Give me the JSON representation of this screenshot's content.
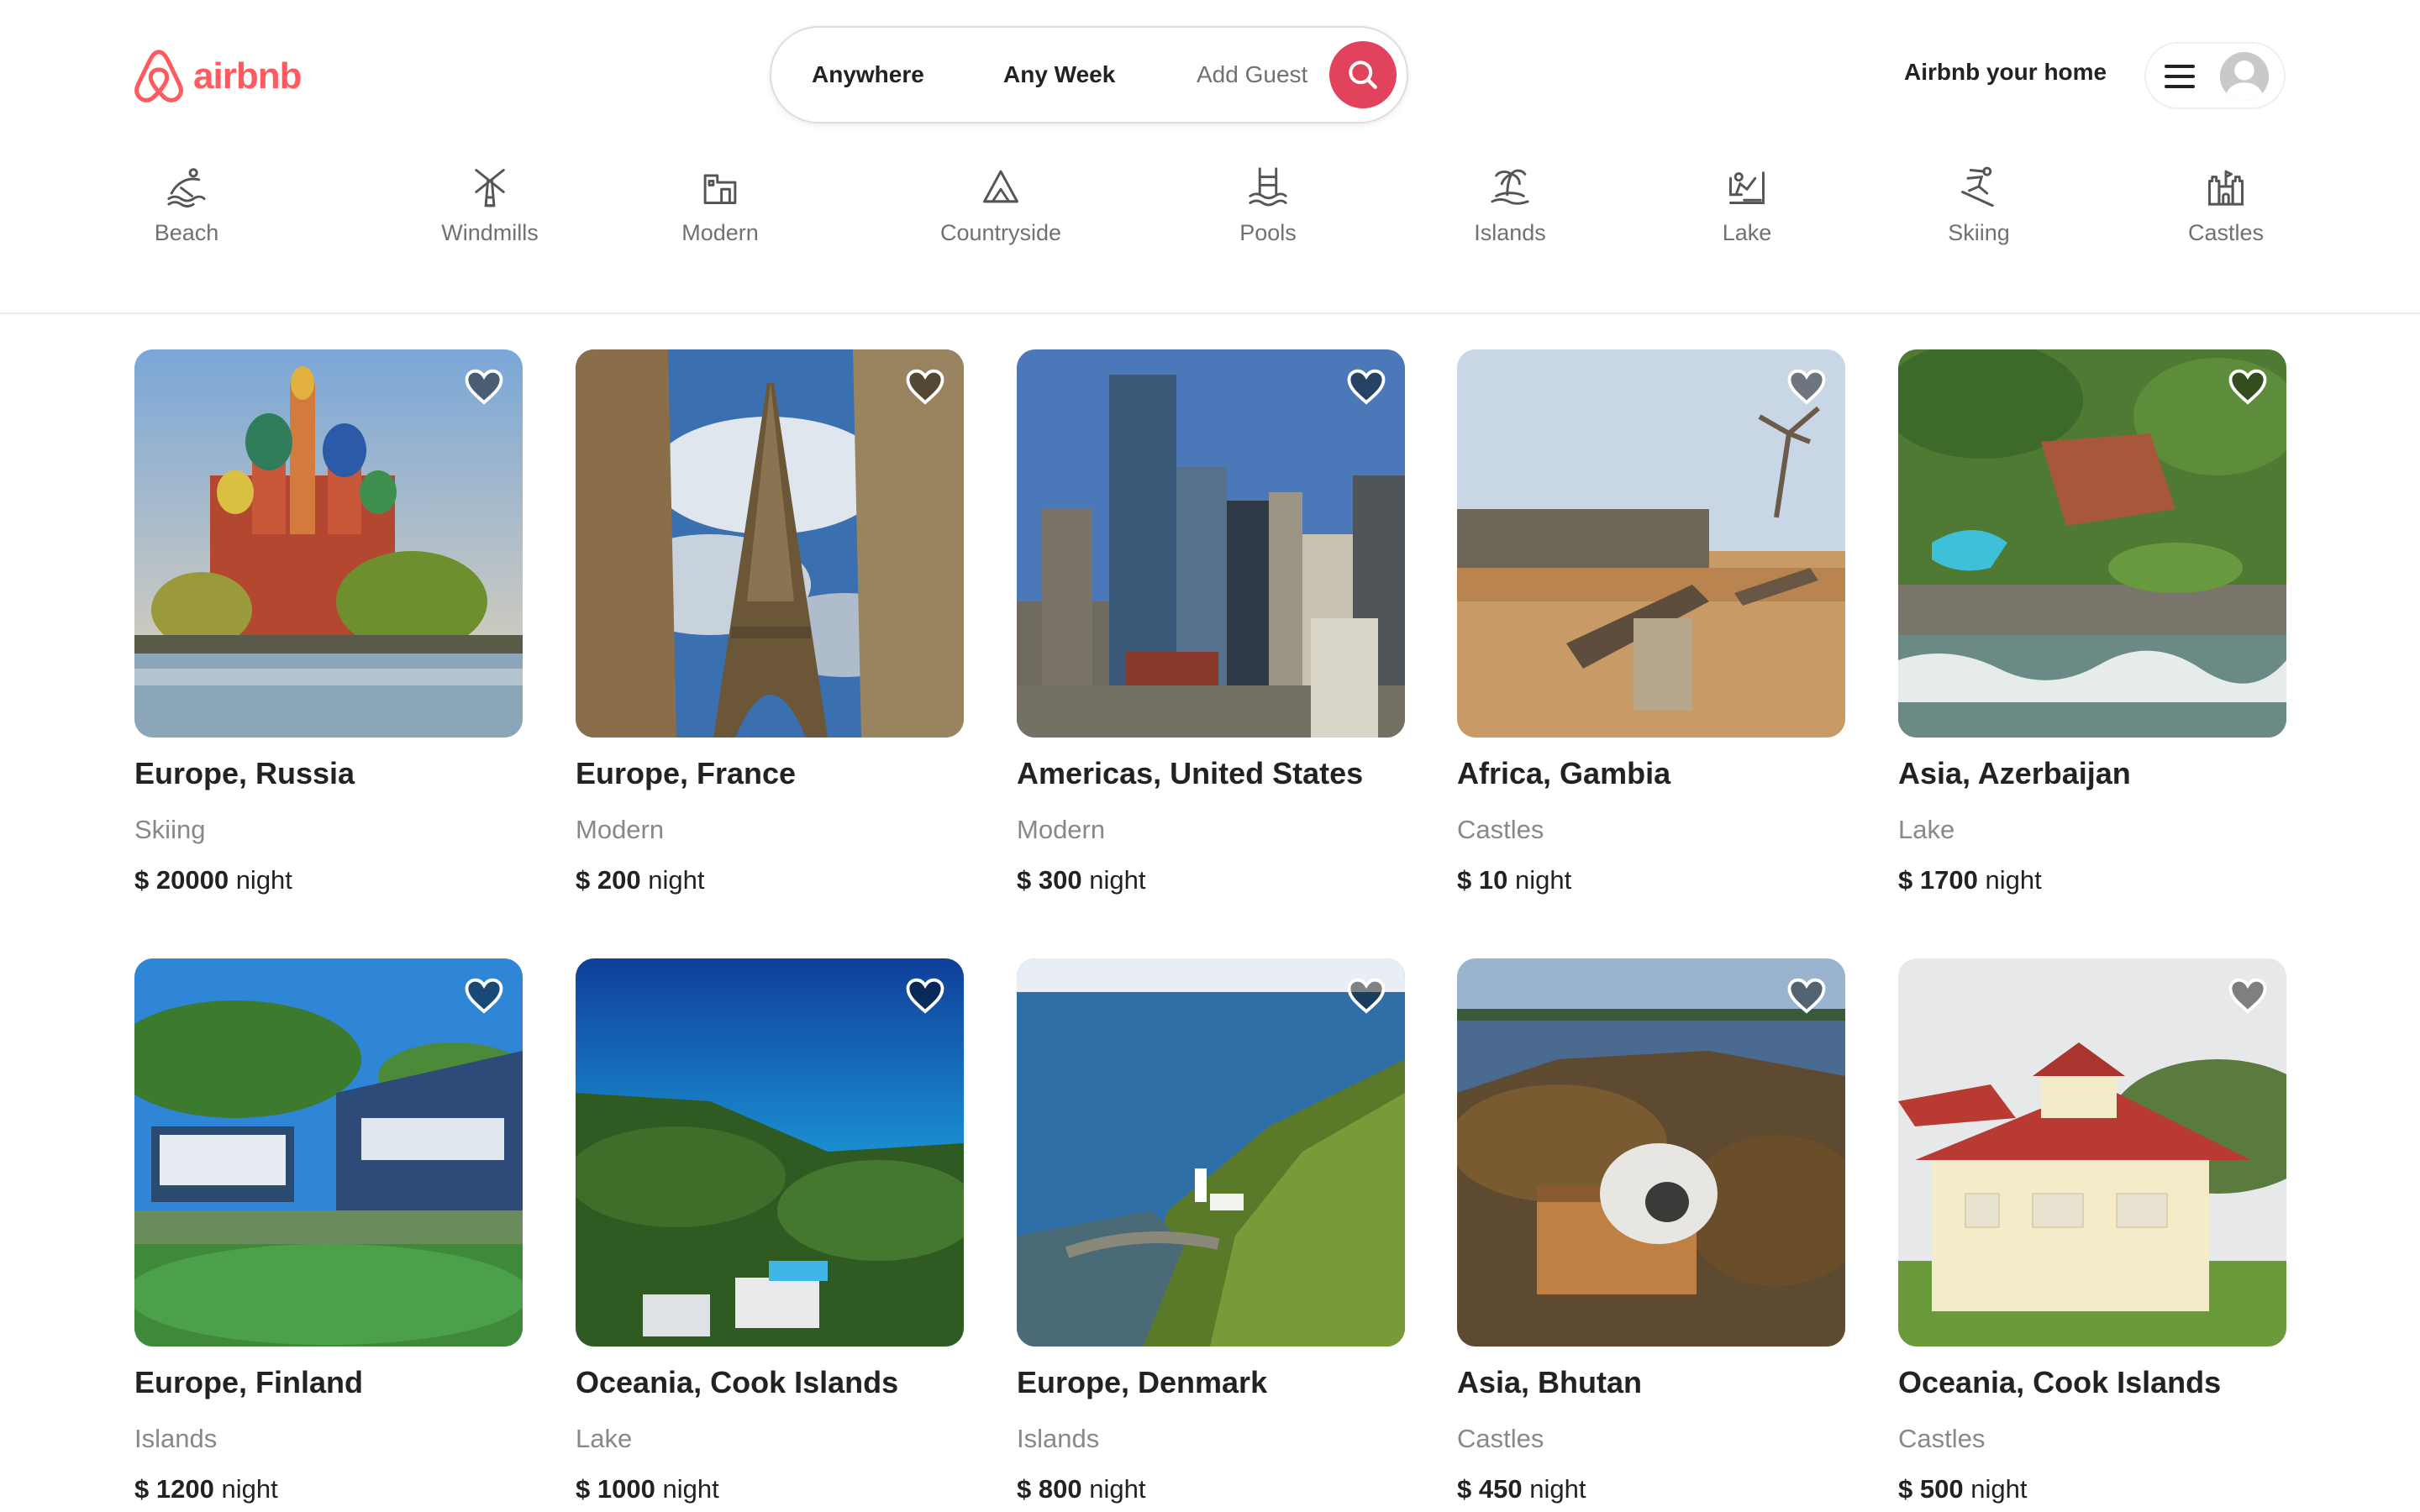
{
  "brand": {
    "name": "airbnb",
    "color": "#FF5A5F"
  },
  "search": {
    "anywhere": "Anywhere",
    "week": "Any Week",
    "guest": "Add Guest",
    "button_color": "#E1435C",
    "icon": "search-icon"
  },
  "header": {
    "host_link": "Airbnb your home",
    "menu_icon": "menu-icon",
    "avatar_icon": "avatar-icon"
  },
  "categories": [
    {
      "label": "Beach",
      "icon": "beach-icon"
    },
    {
      "label": "Windmills",
      "icon": "windmill-icon"
    },
    {
      "label": "Modern",
      "icon": "modern-house-icon"
    },
    {
      "label": "Countryside",
      "icon": "countryside-icon"
    },
    {
      "label": "Pools",
      "icon": "pool-icon"
    },
    {
      "label": "Islands",
      "icon": "island-icon"
    },
    {
      "label": "Lake",
      "icon": "lake-icon"
    },
    {
      "label": "Skiing",
      "icon": "skiing-icon"
    },
    {
      "label": "Castles",
      "icon": "castle-icon"
    }
  ],
  "listings": [
    {
      "title": "Europe, Russia",
      "category": "Skiing",
      "price": "$ 20000",
      "unit": "night",
      "photo": "saint-basils-cathedral-photo"
    },
    {
      "title": "Europe, France",
      "category": "Modern",
      "price": "$ 200",
      "unit": "night",
      "photo": "eiffel-tower-photo"
    },
    {
      "title": "Americas, United States",
      "category": "Modern",
      "price": "$ 300",
      "unit": "night",
      "photo": "city-skyline-photo"
    },
    {
      "title": "Africa, Gambia",
      "category": "Castles",
      "price": "$ 10",
      "unit": "night",
      "photo": "fort-cannon-photo"
    },
    {
      "title": "Asia, Azerbaijan",
      "category": "Lake",
      "price": "$ 1700",
      "unit": "night",
      "photo": "resort-aerial-photo"
    },
    {
      "title": "Europe, Finland",
      "category": "Islands",
      "price": "$ 1200",
      "unit": "night",
      "photo": "lake-house-photo"
    },
    {
      "title": "Oceania, Cook Islands",
      "category": "Lake",
      "price": "$ 1000",
      "unit": "night",
      "photo": "coastal-villa-photo"
    },
    {
      "title": "Europe, Denmark",
      "category": "Islands",
      "price": "$ 800",
      "unit": "night",
      "photo": "lighthouse-coast-photo"
    },
    {
      "title": "Asia, Bhutan",
      "category": "Castles",
      "price": "$ 450",
      "unit": "night",
      "photo": "dome-cabin-photo"
    },
    {
      "title": "Oceania, Cook Islands",
      "category": "Castles",
      "price": "$ 500",
      "unit": "night",
      "photo": "red-roof-house-photo"
    }
  ]
}
